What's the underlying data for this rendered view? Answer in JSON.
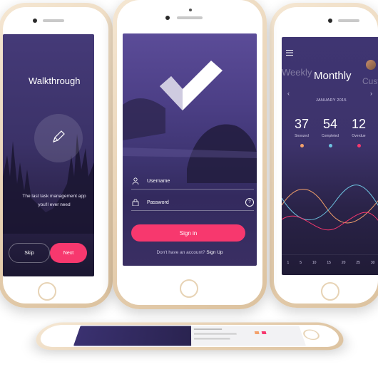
{
  "walkthrough": {
    "title": "Walkthrough",
    "description": "The last task management app you'll ever need",
    "skip_label": "Skip",
    "next_label": "Next"
  },
  "login": {
    "username_placeholder": "Username",
    "password_placeholder": "Password",
    "signin_label": "Sign in",
    "signup_prompt": "Don't have an account?",
    "signup_link": "Sign Up"
  },
  "stats": {
    "prev_tab": "Weekly",
    "current_tab": "Monthly",
    "next_tab": "Custom",
    "date": "JANUARY 2015",
    "items": [
      {
        "value": "37",
        "label": "Snoozed",
        "color": "#f3a16b"
      },
      {
        "value": "54",
        "label": "Completed",
        "color": "#6ec3e0"
      },
      {
        "value": "12",
        "label": "Overdue",
        "color": "#f7386e"
      }
    ],
    "axis": [
      "1",
      "5",
      "10",
      "15",
      "20",
      "25",
      "30"
    ]
  },
  "colors": {
    "accent": "#f7386e",
    "purple": "#453a78",
    "gold": "#e6cfb0"
  }
}
